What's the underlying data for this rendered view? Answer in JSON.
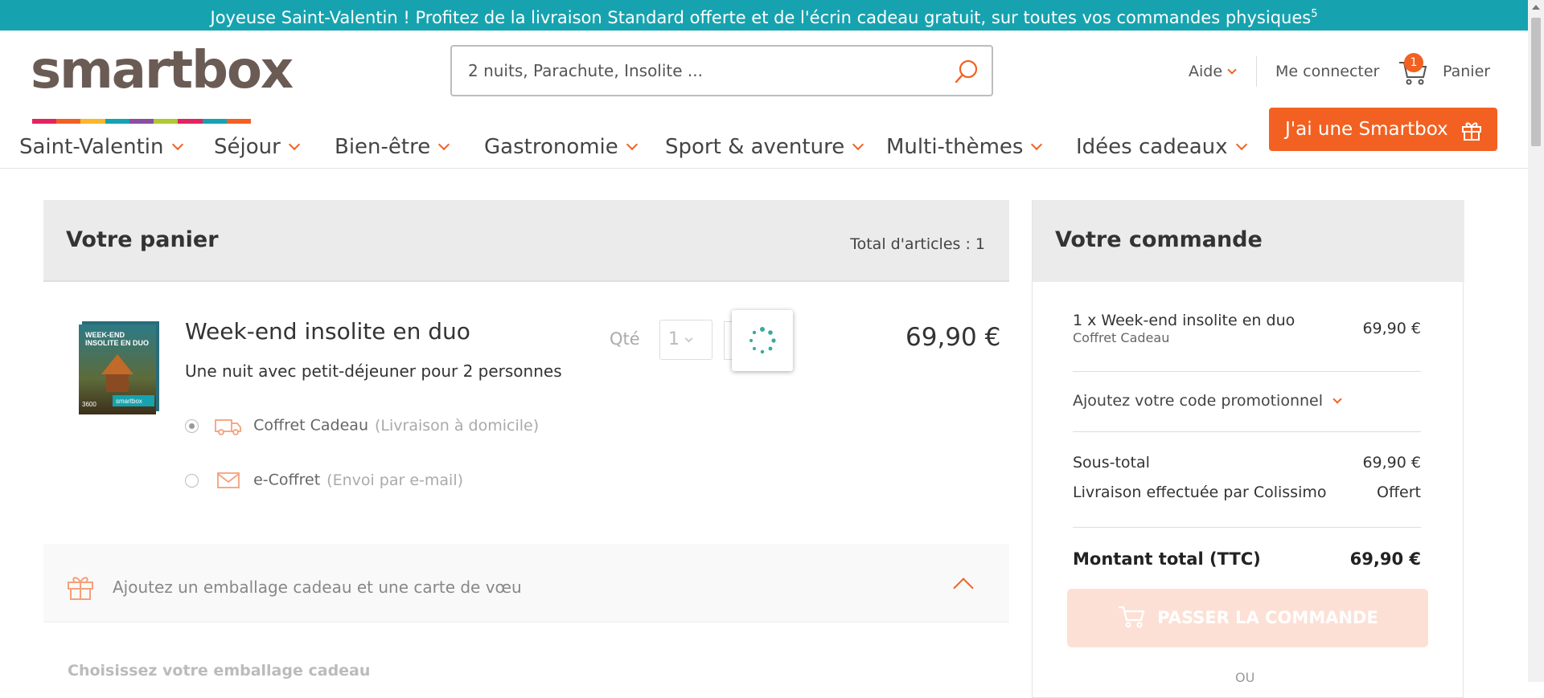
{
  "promo_banner": {
    "text": "Joyeuse Saint-Valentin ! Profitez de la livraison Standard offerte et de l'écrin cadeau gratuit, sur toutes vos commandes physiques",
    "footnote": "5"
  },
  "header": {
    "logo": "smartbox",
    "logo_colors": [
      "#e2245f",
      "#f26122",
      "#fab72b",
      "#16a3af",
      "#8b4f9e",
      "#b0c832",
      "#e2245f",
      "#16a3af",
      "#f26122"
    ],
    "search": {
      "placeholder": "2 nuits, Parachute, Insolite ..."
    },
    "aide": "Aide",
    "connect": "Me connecter",
    "cart_count": "1",
    "cart_label": "Panier"
  },
  "nav": {
    "items": [
      "Saint-Valentin",
      "Séjour",
      "Bien-être",
      "Gastronomie",
      "Sport & aventure",
      "Multi-thèmes",
      "Idées cadeaux"
    ],
    "cta": "J'ai une Smartbox"
  },
  "cart": {
    "title": "Votre panier",
    "total_items": "Total d'articles : 1",
    "product": {
      "title": "Week-end insolite en duo",
      "subtitle": "Une nuit avec petit-déjeuner pour 2 personnes",
      "box_text": "WEEK-END INSOLITE EN DUO",
      "box_brand": "smartbox",
      "box_count": "3600",
      "qty_label": "Qté",
      "qty_value": "1",
      "price": "69,90 €",
      "options": [
        {
          "label": "Coffret Cadeau",
          "note": "(Livraison à domicile)",
          "selected": true
        },
        {
          "label": "e-Coffret",
          "note": "(Envoi par e-mail)",
          "selected": false
        }
      ]
    },
    "gift_wrap": {
      "label": "Ajoutez un emballage cadeau et une carte de vœu",
      "section_title": "Choisissez votre emballage cadeau"
    }
  },
  "order": {
    "title": "Votre commande",
    "line_item": "1 x Week-end insolite en duo",
    "line_item_type": "Coffret Cadeau",
    "line_item_price": "69,90 €",
    "promo_code": "Ajoutez votre code promotionnel",
    "subtotal_label": "Sous-total",
    "subtotal_value": "69,90 €",
    "shipping_label": "Livraison effectuée par Colissimo",
    "shipping_value": "Offert",
    "total_label": "Montant total (TTC)",
    "total_value": "69,90 €",
    "checkout_label": "PASSER LA COMMANDE",
    "or_label": "OU"
  },
  "colors": {
    "brand_orange": "#f26122",
    "banner_teal": "#16a3af"
  }
}
